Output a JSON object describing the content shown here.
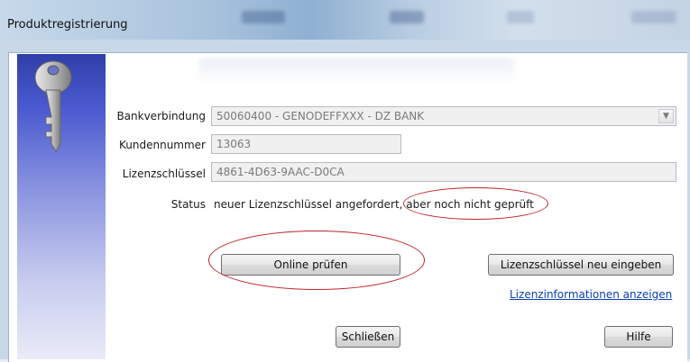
{
  "window": {
    "title": "Produktregistrierung"
  },
  "form": {
    "bank_label": "Bankverbindung",
    "bank_value": "50060400 - GENODEFFXXX - DZ BANK",
    "customer_label": "Kundennummer",
    "customer_value": "13063",
    "license_label": "Lizenzschlüssel",
    "license_value": "4861-4D63-9AAC-D0CA",
    "status_label": "Status",
    "status_value": "neuer Lizenzschlüssel angefordert, aber noch nicht geprüft"
  },
  "buttons": {
    "online_check": "Online prüfen",
    "reenter_key": "Lizenzschlüssel neu eingeben",
    "close": "Schließen",
    "help": "Hilfe"
  },
  "links": {
    "license_info": "Lizenzinformationen anzeigen"
  },
  "colors": {
    "annotation": "#c0242b",
    "link": "#0b3fb0",
    "banner_top": "#2f3fa8"
  },
  "icons": {
    "banner": "key-icon",
    "combo": "chevron-down-icon"
  }
}
